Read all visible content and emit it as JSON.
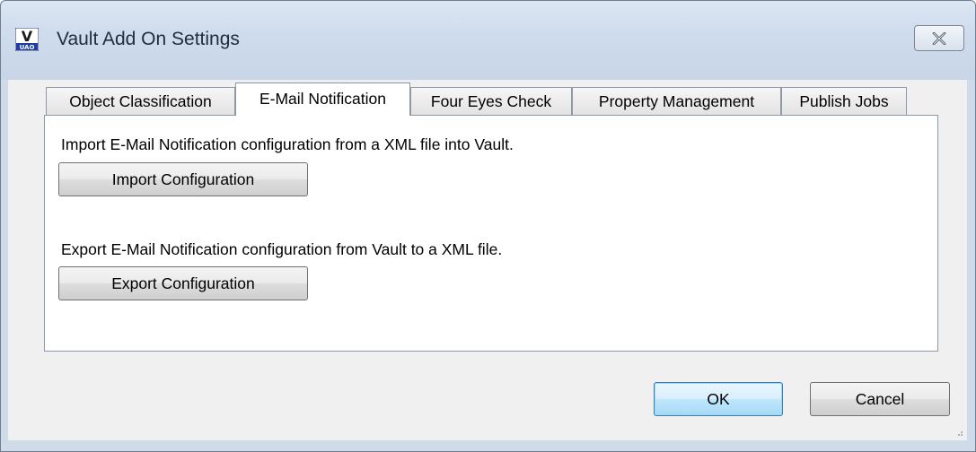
{
  "window": {
    "title": "Vault Add On Settings",
    "app_icon_letter": "V",
    "app_icon_caption": "UAO",
    "close_glyph": "close-icon"
  },
  "tabs": [
    {
      "label": "Object Classification",
      "active": false
    },
    {
      "label": "E-Mail Notification",
      "active": true
    },
    {
      "label": "Four Eyes Check",
      "active": false
    },
    {
      "label": "Property Management",
      "active": false
    },
    {
      "label": "Publish Jobs",
      "active": false
    }
  ],
  "panel": {
    "import_text": "Import E-Mail Notification configuration from a XML file into Vault.",
    "import_button": "Import Configuration",
    "export_text": "Export E-Mail Notification configuration from Vault to a XML file.",
    "export_button": "Export Configuration"
  },
  "buttons": {
    "ok": "OK",
    "cancel": "Cancel"
  },
  "colors": {
    "frame": "#cfdbe9",
    "client": "#f0f0f0",
    "default_button": "#bee6fd"
  }
}
